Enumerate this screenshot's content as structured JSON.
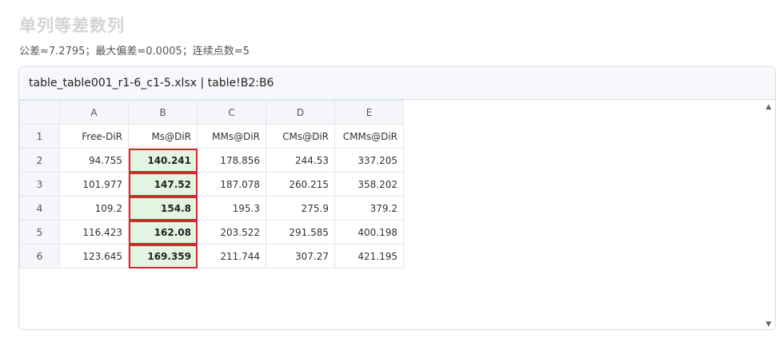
{
  "page": {
    "title": "单列等差数列",
    "summary": "公差≈7.2795；最大偏差=0.0005；连续点数=5"
  },
  "panel": {
    "header": "table_table001_r1-6_c1-5.xlsx | table!B2:B6"
  },
  "sheet": {
    "columns": [
      "A",
      "B",
      "C",
      "D",
      "E"
    ],
    "rows": [
      {
        "num": "1",
        "cells": [
          "Free-DiR",
          "Ms@DiR",
          "MMs@DiR",
          "CMs@DiR",
          "CMMs@DiR"
        ]
      },
      {
        "num": "2",
        "cells": [
          "94.755",
          "140.241",
          "178.856",
          "244.53",
          "337.205"
        ]
      },
      {
        "num": "3",
        "cells": [
          "101.977",
          "147.52",
          "187.078",
          "260.215",
          "358.202"
        ]
      },
      {
        "num": "4",
        "cells": [
          "109.2",
          "154.8",
          "195.3",
          "275.9",
          "379.2"
        ]
      },
      {
        "num": "5",
        "cells": [
          "116.423",
          "162.08",
          "203.522",
          "291.585",
          "400.198"
        ]
      },
      {
        "num": "6",
        "cells": [
          "123.645",
          "169.359",
          "211.744",
          "307.27",
          "421.195"
        ]
      }
    ],
    "highlight_color": "#d9262c",
    "highlight_fill": "#e3f5e1"
  },
  "scrollbar": {
    "up_icon": "▲",
    "down_icon": "▼"
  }
}
